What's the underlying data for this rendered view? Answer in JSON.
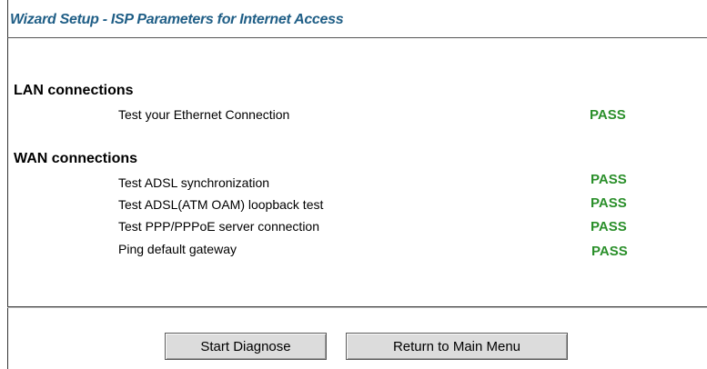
{
  "header": {
    "title": "Wizard Setup - ISP Parameters for Internet Access"
  },
  "lan": {
    "heading": "LAN connections",
    "tests": [
      {
        "label": "Test your Ethernet Connection",
        "result": "PASS"
      }
    ]
  },
  "wan": {
    "heading": "WAN connections",
    "tests": [
      {
        "label": "Test ADSL synchronization",
        "result": "PASS"
      },
      {
        "label": "Test ADSL(ATM OAM) loopback test",
        "result": "PASS"
      },
      {
        "label": "Test PPP/PPPoE server connection",
        "result": "PASS"
      },
      {
        "label": "Ping default gateway",
        "result": "PASS"
      }
    ]
  },
  "buttons": {
    "start_diagnose": "Start Diagnose",
    "return_main_menu": "Return to Main Menu"
  },
  "colors": {
    "title": "#1f5e86",
    "pass": "#2a8f2a"
  }
}
